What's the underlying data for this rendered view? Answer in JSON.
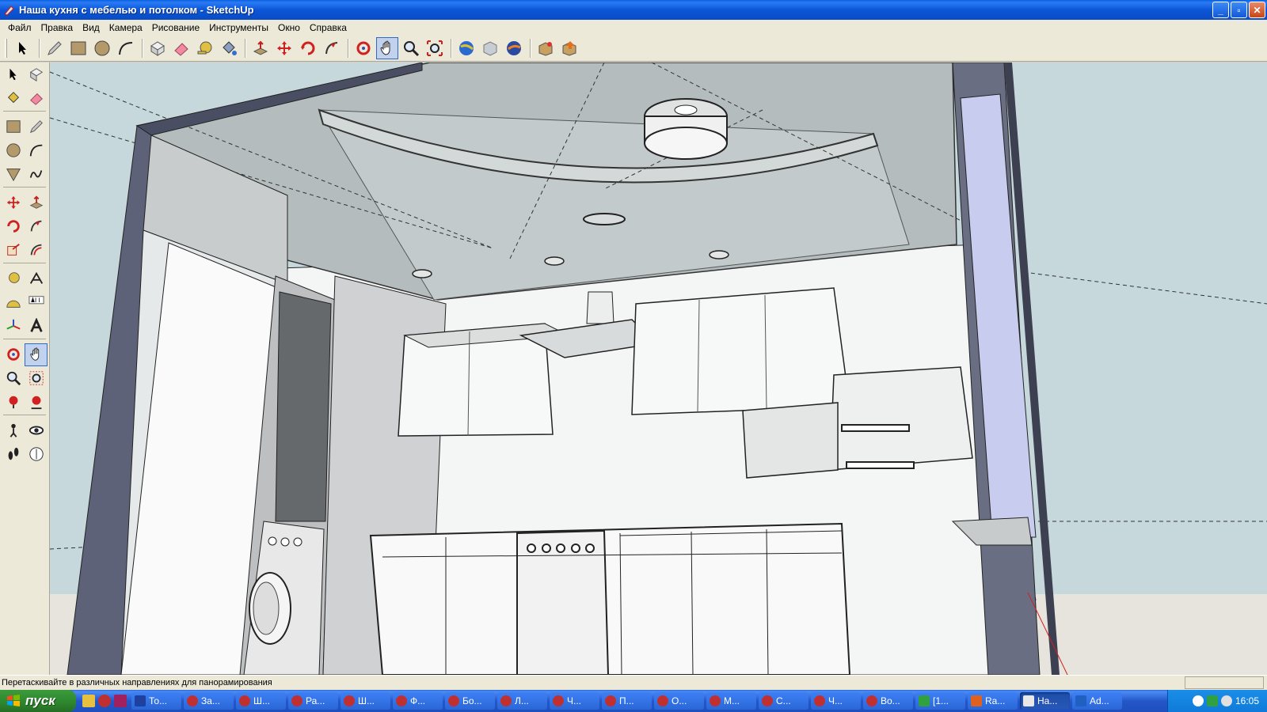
{
  "window": {
    "title": "Наша кухня с мебелью и потолком - SketchUp",
    "controls": [
      "_",
      "▫",
      "✕"
    ]
  },
  "menu": [
    "Файл",
    "Правка",
    "Вид",
    "Камера",
    "Рисование",
    "Инструменты",
    "Окно",
    "Справка"
  ],
  "toolbar": {
    "tools": [
      "select",
      "pencil",
      "rectangle",
      "circle",
      "arc",
      "make-component",
      "eraser",
      "tape-measure",
      "paint-bucket",
      "push-pull",
      "move",
      "rotate",
      "follow-me",
      "orbit",
      "pan",
      "zoom",
      "zoom-extents",
      "get-models",
      "share-model",
      "google-earth",
      "component-warehouse",
      "share-component"
    ],
    "active": "pan"
  },
  "left_toolbar": {
    "tools": [
      "select",
      "make-component",
      "paint-bucket",
      "eraser",
      "rectangle",
      "line",
      "circle",
      "arc",
      "polygon",
      "freehand",
      "move",
      "push-pull",
      "rotate",
      "follow-me",
      "scale",
      "offset",
      "tape-measure",
      "dimension",
      "protractor",
      "text",
      "axes",
      "3d-text",
      "orbit",
      "pan",
      "zoom",
      "zoom-window",
      "previous",
      "zoom-extents",
      "position-camera",
      "look-around",
      "walk",
      "section-plane"
    ],
    "active": "pan"
  },
  "status": {
    "message": "Перетаскивайте в различных направлениях для панорамирования"
  },
  "taskbar": {
    "start_label": "пуск",
    "tasks": [
      "То...",
      "За...",
      "Ш...",
      "Ра...",
      "Ш...",
      "Ф...",
      "Бо...",
      "Л...",
      "Ч...",
      "П...",
      "О...",
      "М...",
      "С...",
      "Ч...",
      "Во...",
      "[1...",
      "Ra...",
      "На...",
      "Ad..."
    ],
    "active_task": 17,
    "clock": "16:05"
  },
  "colors": {
    "titlebar": "#0a5fe0",
    "menubar": "#ece9d8",
    "sky": "#c6d8db",
    "ground": "#e6e4dc",
    "taskbar": "#2457c8",
    "start": "#3c9a3c"
  }
}
